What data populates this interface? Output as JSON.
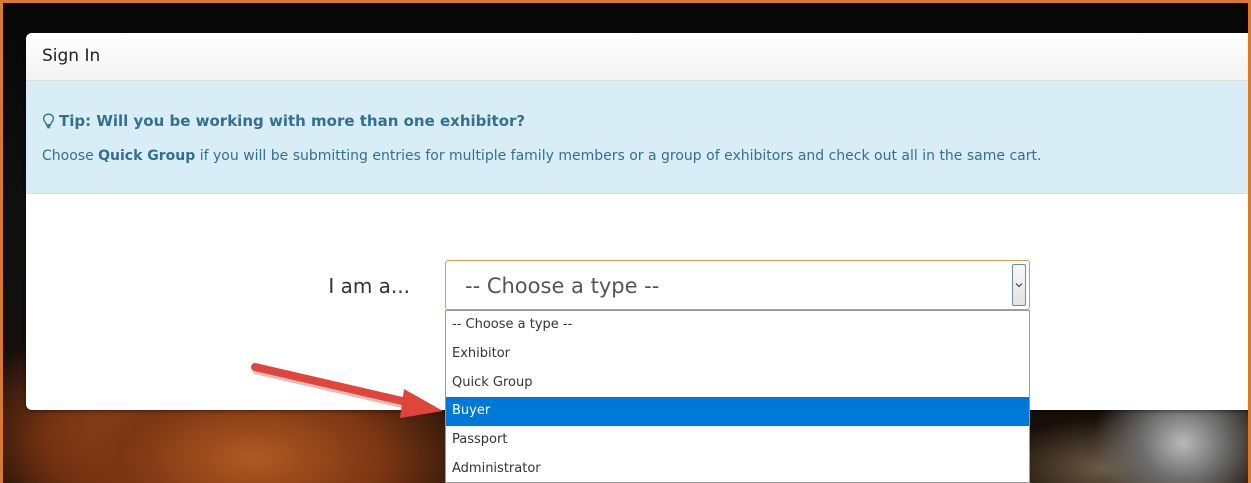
{
  "modal": {
    "title": "Sign In"
  },
  "tip": {
    "icon": "lightbulb-icon",
    "title": "Tip: Will you be working with more than one exhibitor?",
    "body_prefix": "Choose ",
    "body_highlight": "Quick Group",
    "body_suffix": " if you will be submitting entries for multiple family members or a group of exhibitors and check out all in the same cart.",
    "text_color": "#31708f",
    "background_color": "#d9edf7"
  },
  "form": {
    "label": "I am a...",
    "select": {
      "value": "-- Choose a type --",
      "border_color": "#d89a4a"
    },
    "dropdown": {
      "options": [
        "-- Choose a type --",
        "Exhibitor",
        "Quick Group",
        "Buyer",
        "Passport",
        "Administrator"
      ],
      "highlighted_option": "Buyer",
      "highlight_color": "#0078d7"
    }
  },
  "annotation": {
    "arrow_color": "#e0453b",
    "arrow_target": "Buyer"
  },
  "frame": {
    "border_color": "#d9782f"
  }
}
